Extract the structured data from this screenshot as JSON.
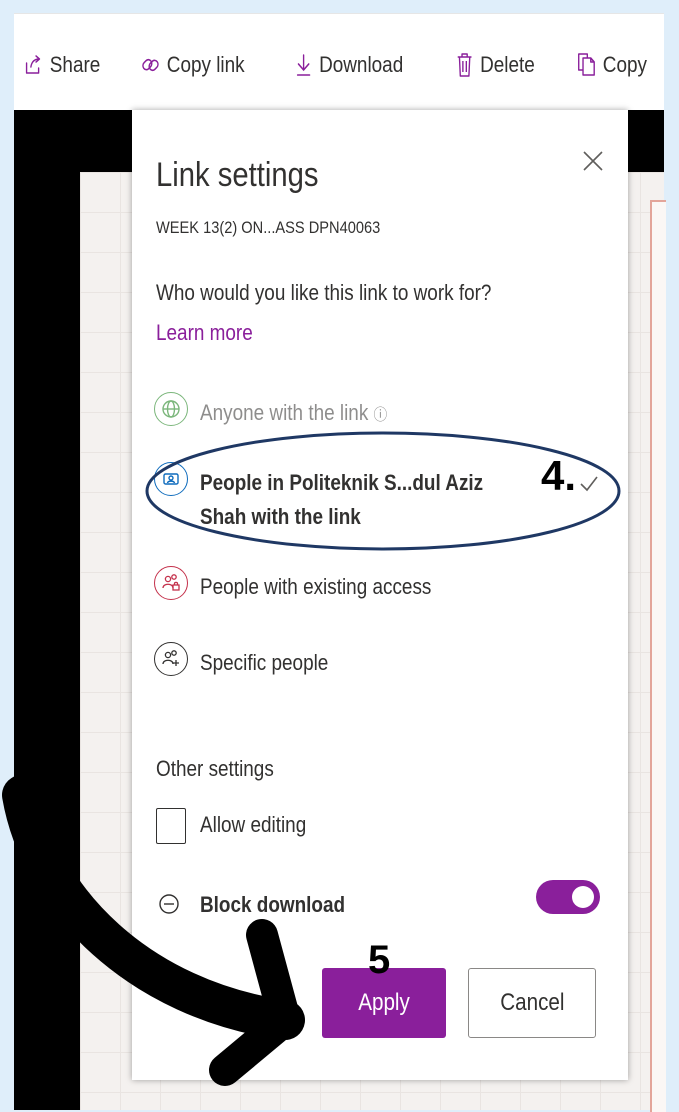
{
  "toolbar": {
    "share": "Share",
    "copy_link": "Copy link",
    "download": "Download",
    "delete": "Delete",
    "copy": "Copy"
  },
  "panel": {
    "title": "Link settings",
    "filename": "WEEK 13(2) ON...ASS DPN40063",
    "question": "Who would you like this link to work for?",
    "learn_more": "Learn more",
    "options": [
      {
        "label": "Anyone with the link",
        "icon": "globe-icon",
        "color": "#107c10",
        "disabled": true
      },
      {
        "label_line1": "People in Politeknik S...dul Aziz",
        "label_line2": "Shah with the link",
        "icon": "organization-icon",
        "color": "#0f6cbd",
        "selected": true
      },
      {
        "label": "People with existing access",
        "icon": "people-lock-icon",
        "color": "#c4314b"
      },
      {
        "label": "Specific people",
        "icon": "people-add-icon",
        "color": "#323130"
      }
    ],
    "other_settings": "Other settings",
    "allow_editing": "Allow editing",
    "block_download": "Block download",
    "block_download_on": true,
    "apply": "Apply",
    "cancel": "Cancel"
  },
  "annotations": {
    "step4": "4.",
    "step5": "5"
  },
  "colors": {
    "accent": "#8a1f9b",
    "annotation_ellipse": "#1f3864"
  }
}
